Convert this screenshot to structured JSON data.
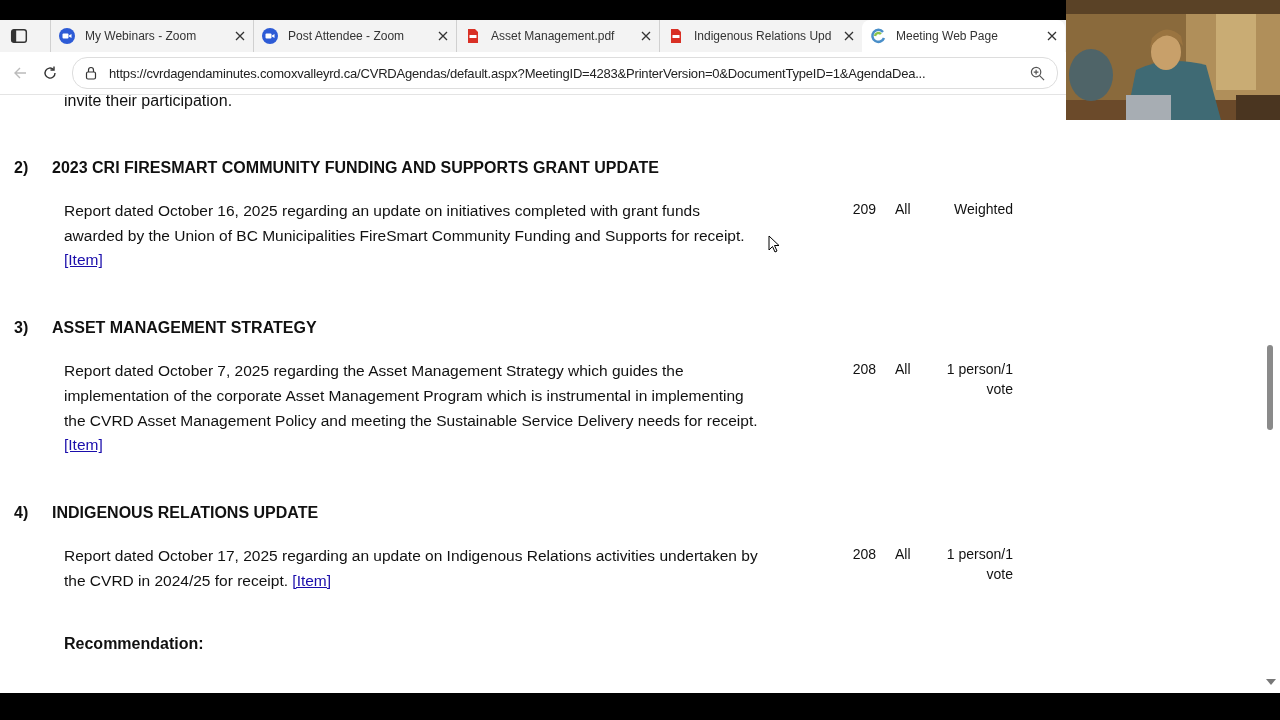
{
  "tabs": [
    {
      "kind": "zoom",
      "label": "My Webinars - Zoom",
      "selected": false
    },
    {
      "kind": "zoom",
      "label": "Post Attendee - Zoom",
      "selected": false
    },
    {
      "kind": "pdf",
      "label": "Asset Management.pdf",
      "selected": false
    },
    {
      "kind": "pdf",
      "label": "Indigenous Relations Upd",
      "selected": false
    },
    {
      "kind": "web",
      "label": "Meeting Web Page",
      "selected": true
    }
  ],
  "address": "https://cvrdagendaminutes.comoxvalleyrd.ca/CVRDAgendas/default.aspx?MeetingID=4283&PrinterVersion=0&DocumentTypeID=1&AgendaDea...",
  "intro_tail": "invite their participation.",
  "items": [
    {
      "number": "2)",
      "title": "2023 CRI FIRESMART COMMUNITY FUNDING AND SUPPORTS GRANT UPDATE",
      "report": "Report dated October 16, 2025 regarding an update on initiatives completed with grant funds awarded by the Union of BC Municipalities FireSmart Community Funding and Supports for receipt.",
      "link": "[Item]",
      "pages": "209",
      "voters": "All",
      "vote": "Weighted"
    },
    {
      "number": "3)",
      "title": "ASSET MANAGEMENT STRATEGY",
      "report": "Report dated October 7, 2025 regarding the Asset Management Strategy which guides the implementation of the corporate Asset Management Program which is instrumental in implementing the CVRD Asset Management Policy and meeting the Sustainable Service Delivery needs for receipt.",
      "link": "[Item]",
      "pages": "208",
      "voters": "All",
      "vote": "1 person/1 vote"
    },
    {
      "number": "4)",
      "title": "INDIGENOUS RELATIONS UPDATE",
      "report": "Report dated October 17, 2025 regarding an update on Indigenous Relations activities undertaken by the CVRD in 2024/25 for receipt.",
      "link": "[Item]",
      "pages": "208",
      "voters": "All",
      "vote": "1 person/1 vote",
      "subheading": "Recommendation:"
    }
  ]
}
